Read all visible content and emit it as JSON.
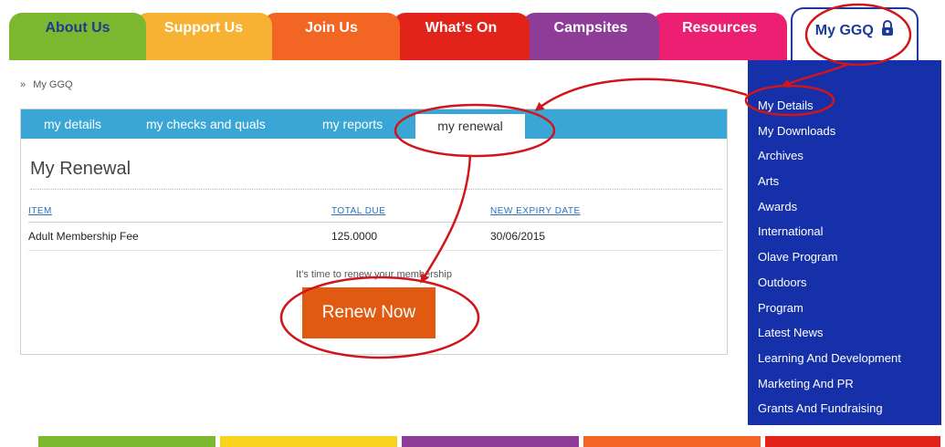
{
  "topnav": {
    "tabs": [
      {
        "label": "About Us"
      },
      {
        "label": "Support Us"
      },
      {
        "label": "Join Us"
      },
      {
        "label": "What’s On"
      },
      {
        "label": "Campsites"
      },
      {
        "label": "Resources"
      },
      {
        "label": "My GGQ"
      }
    ],
    "colors": [
      "#7cb82f",
      "#f8b233",
      "#f26522",
      "#e2231a",
      "#8e3c97",
      "#ec1f73",
      "#1c3a9c"
    ]
  },
  "breadcrumb": {
    "separator": "»",
    "current": "My GGQ"
  },
  "panel": {
    "tabs": [
      {
        "label": "my details"
      },
      {
        "label": "my checks and quals"
      },
      {
        "label": "my reports"
      },
      {
        "label": "my renewal"
      }
    ],
    "title": "My Renewal",
    "table": {
      "headers": [
        "ITEM",
        "TOTAL DUE",
        "NEW EXPIRY DATE"
      ],
      "rows": [
        {
          "item": "Adult Membership Fee",
          "total_due": "125.0000",
          "new_expiry_date": "30/06/2015"
        }
      ]
    },
    "message": "It’s time to renew your membership",
    "renew_button": "Renew Now"
  },
  "sidemenu": {
    "items": [
      "My Details",
      "My Downloads",
      "Archives",
      "Arts",
      "Awards",
      "International",
      "Olave Program",
      "Outdoors",
      "Program",
      "Latest News",
      "Learning And Development",
      "Marketing And PR",
      "Grants And Fundraising"
    ]
  },
  "footer_bar_colors": [
    "#7cb82f",
    "#f8d21c",
    "#8e3c97",
    "#f26522",
    "#e2231a"
  ],
  "annotation_color": "#d0151b"
}
